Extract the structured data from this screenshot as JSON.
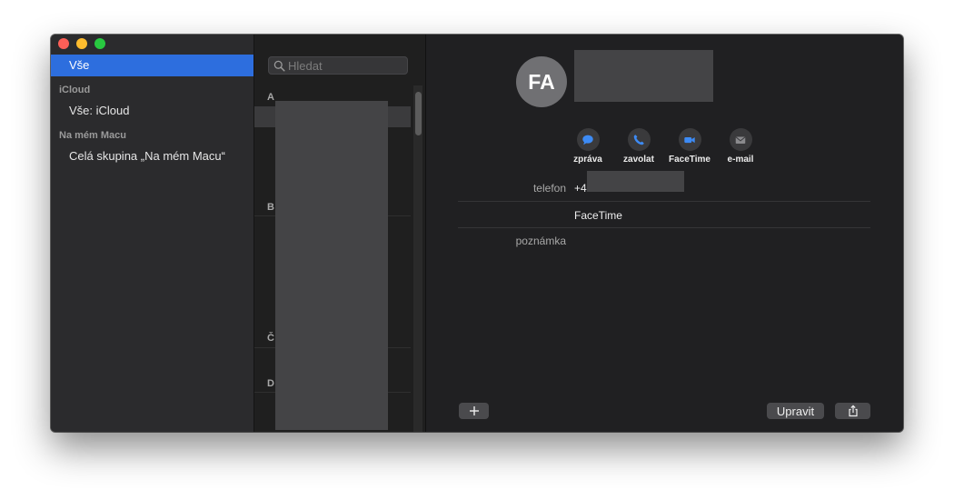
{
  "sidebar": {
    "items": [
      {
        "label": "Vše",
        "selected": true
      },
      {
        "header": "iCloud"
      },
      {
        "label": "Vše: iCloud",
        "selected": false
      },
      {
        "header": "Na mém Macu"
      },
      {
        "label": "Celá skupina „Na mém Macu“",
        "selected": false
      }
    ]
  },
  "list": {
    "search_placeholder": "Hledat",
    "letters": [
      "A",
      "B",
      "Č",
      "D"
    ]
  },
  "contact": {
    "initials": "FA",
    "phone_prefix": "+4",
    "actions": [
      {
        "label": "zpráva",
        "icon": "message-bubble-icon"
      },
      {
        "label": "zavolat",
        "icon": "phone-icon"
      },
      {
        "label": "FaceTime",
        "icon": "video-camera-icon"
      },
      {
        "label": "e-mail",
        "icon": "envelope-icon"
      }
    ],
    "fields": {
      "phone_label": "telefon",
      "facetime_value": "FaceTime",
      "note_label": "poznámka"
    }
  },
  "footer": {
    "add_icon": "plus-icon",
    "edit_label": "Upravit",
    "share_icon": "share-icon"
  },
  "colors": {
    "selection": "#2d6ede",
    "action_icon": "#3d8bf5",
    "window_bg": "#1e1e1e"
  }
}
